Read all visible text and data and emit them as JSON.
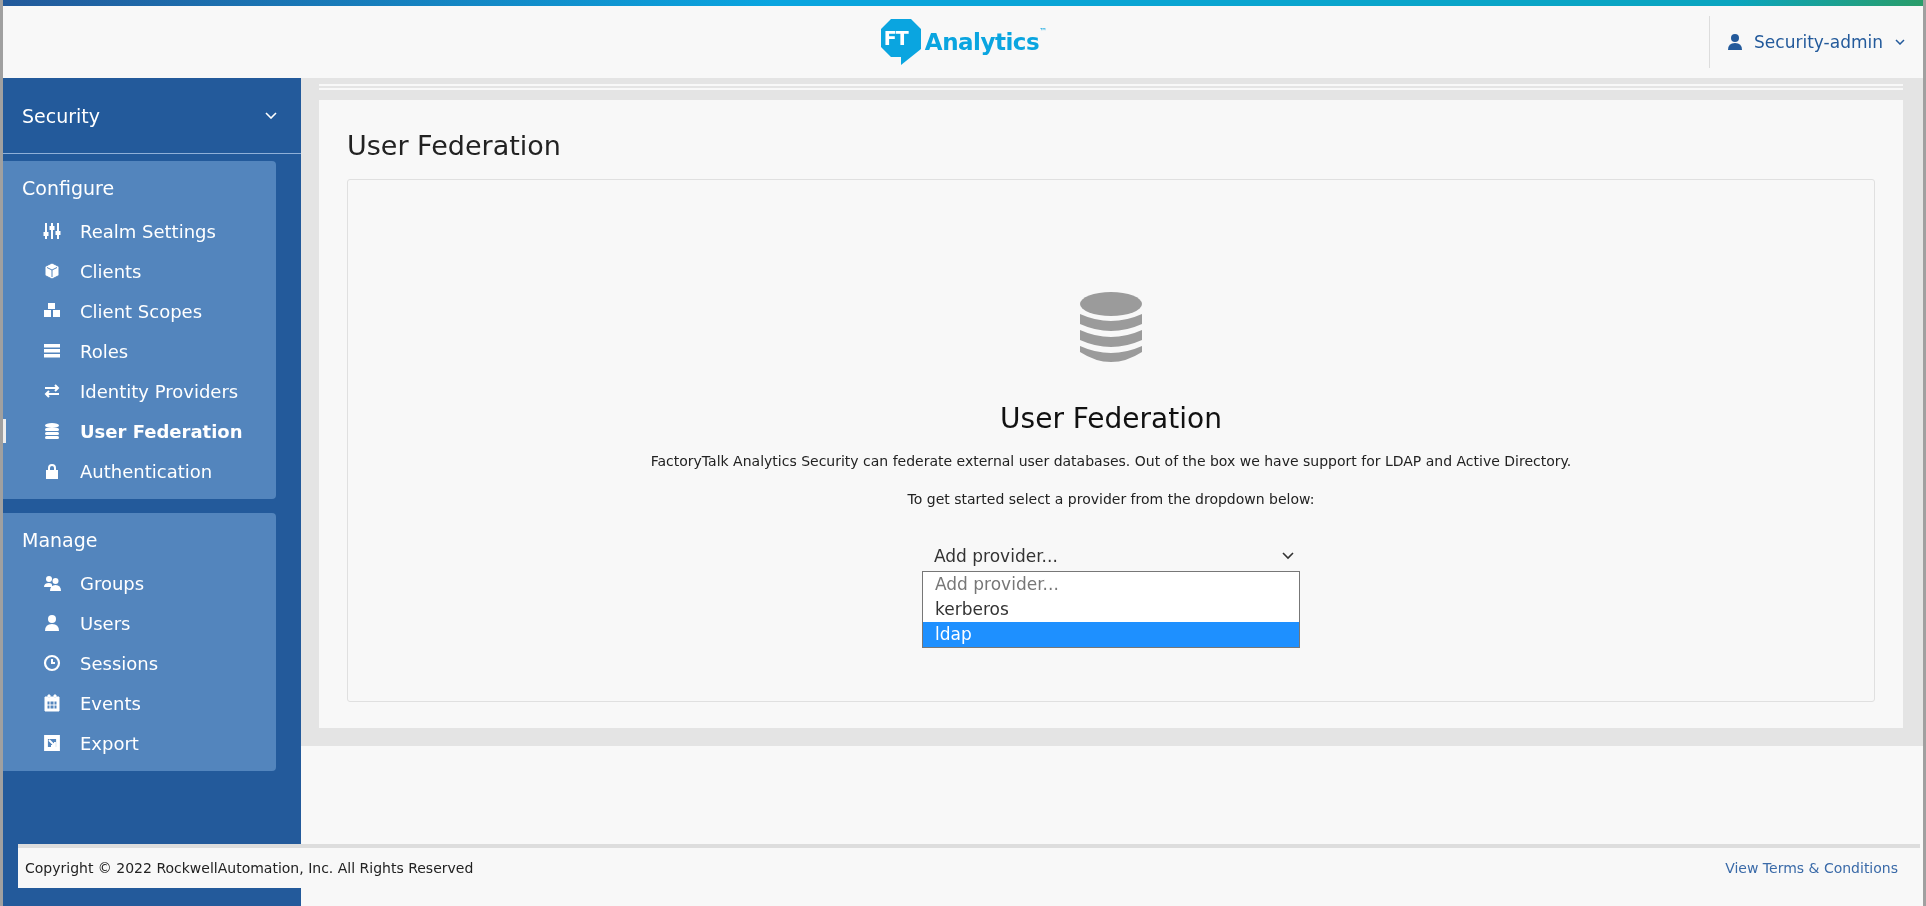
{
  "header": {
    "logo": {
      "mark": "FT",
      "name": "Analytics",
      "trademark": "™"
    },
    "user": "Security-admin"
  },
  "sidebar": {
    "realm": "Security",
    "sections": [
      {
        "title": "Configure",
        "items": [
          {
            "label": "Realm Settings",
            "kind": "sliders",
            "selected": false
          },
          {
            "label": "Clients",
            "kind": "cube",
            "selected": false
          },
          {
            "label": "Client Scopes",
            "kind": "cubes",
            "selected": false
          },
          {
            "label": "Roles",
            "kind": "list",
            "selected": false
          },
          {
            "label": "Identity Providers",
            "kind": "exchange",
            "selected": false
          },
          {
            "label": "User Federation",
            "kind": "database",
            "selected": true
          },
          {
            "label": "Authentication",
            "kind": "lock",
            "selected": false
          }
        ]
      },
      {
        "title": "Manage",
        "items": [
          {
            "label": "Groups",
            "kind": "users",
            "selected": false
          },
          {
            "label": "Users",
            "kind": "user",
            "selected": false
          },
          {
            "label": "Sessions",
            "kind": "clock",
            "selected": false
          },
          {
            "label": "Events",
            "kind": "calendar",
            "selected": false
          },
          {
            "label": "Export",
            "kind": "export",
            "selected": false
          }
        ]
      }
    ]
  },
  "page": {
    "title": "User Federation",
    "heading": "User Federation",
    "description": "FactoryTalk Analytics Security can federate external user databases. Out of the box we have support for LDAP and Active Directory.",
    "instruction": "To get started select a provider from the dropdown below:",
    "provider_select": {
      "value": "Add provider...",
      "options": [
        {
          "label": "Add provider...",
          "highlighted": false,
          "disabled": true
        },
        {
          "label": "kerberos",
          "highlighted": false,
          "disabled": false
        },
        {
          "label": "ldap",
          "highlighted": true,
          "disabled": false
        }
      ]
    }
  },
  "footer": {
    "copyright": "Copyright © 2022 RockwellAutomation, Inc. All Rights Reserved",
    "terms_link": "View Terms & Conditions"
  }
}
